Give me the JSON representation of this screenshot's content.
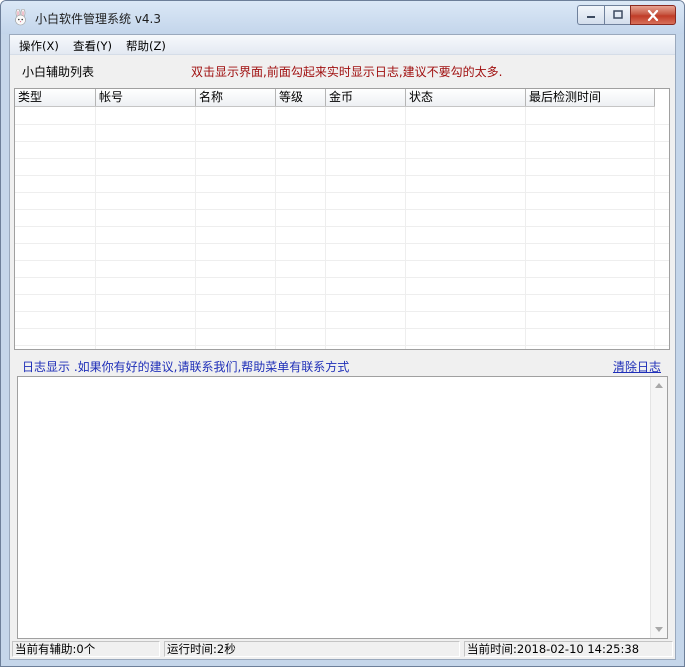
{
  "window": {
    "title": "小白软件管理系统   v4.3"
  },
  "menu": {
    "items": [
      "操作(X)",
      "查看(Y)",
      "帮助(Z)"
    ]
  },
  "list": {
    "label": "小白辅助列表",
    "hint": "双击显示界面,前面勾起来实时显示日志,建议不要勾的太多.",
    "columns": [
      "类型",
      "帐号",
      "名称",
      "等级",
      "金币",
      "状态",
      "最后检测时间"
    ]
  },
  "log": {
    "label": "日志显示  .如果你有好的建议,请联系我们,帮助菜单有联系方式",
    "clear_label": "清除日志",
    "content": ""
  },
  "status": {
    "helpers": "当前有辅助:0个",
    "runtime": "运行时间:2秒",
    "current_time": "当前时间:2018-02-10 14:25:38"
  },
  "colors": {
    "hint": "#a01010",
    "link": "#1f2fb8",
    "close_button": "#c13c27"
  }
}
